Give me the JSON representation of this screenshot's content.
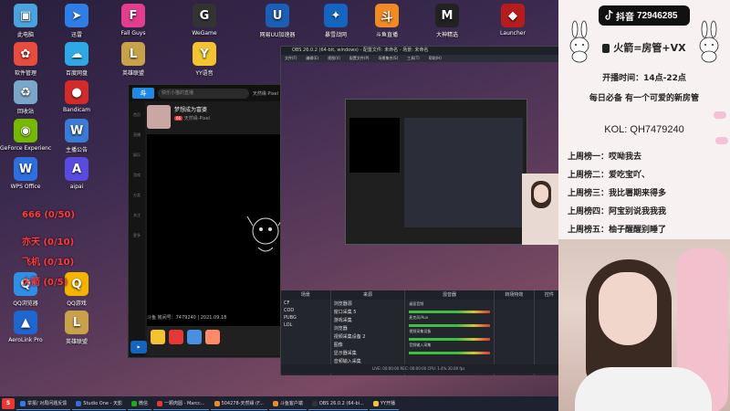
{
  "desktop_icons": [
    {
      "label": "此电脑",
      "icon": "computer-icon",
      "color": "#4aa3df",
      "glyph": "▣"
    },
    {
      "label": "迅雷",
      "icon": "xunlei-icon",
      "color": "#2f7ee6",
      "glyph": "➤"
    },
    {
      "label": "Fall Guys",
      "icon": "fallguys-icon",
      "color": "#e23d8f",
      "glyph": "F"
    },
    {
      "label": "WeGame",
      "icon": "wegame-icon",
      "color": "#333333",
      "glyph": "G"
    },
    {
      "label": "网易UU加速器",
      "icon": "uu-icon",
      "color": "#1c5db5",
      "glyph": "U"
    },
    {
      "label": "暴雪战网",
      "icon": "battlenet-icon",
      "color": "#1565c0",
      "glyph": "✦"
    },
    {
      "label": "斗鱼直播",
      "icon": "douyu-icon",
      "color": "#f08a24",
      "glyph": "斗"
    },
    {
      "label": "大神精选",
      "icon": "mw-icon",
      "color": "#222222",
      "glyph": "M"
    },
    {
      "label": "Launcher",
      "icon": "launcher-icon",
      "color": "#b71c1c",
      "glyph": "◆"
    },
    {
      "label": "软件管理",
      "icon": "apps-icon",
      "color": "#e84c3d",
      "glyph": "✿"
    },
    {
      "label": "百度网盘",
      "icon": "baidu-icon",
      "color": "#2fa8e6",
      "glyph": "☁"
    },
    {
      "label": "英雄联盟",
      "icon": "lol-icon",
      "color": "#c8a24a",
      "glyph": "L"
    },
    {
      "label": "YY语音",
      "icon": "yy-icon",
      "color": "#f4c430",
      "glyph": "Y"
    },
    {
      "label": "回收站",
      "icon": "recycle-bin-icon",
      "color": "#7aa6c9",
      "glyph": "♻"
    },
    {
      "label": "Bandicam",
      "icon": "bandicam-icon",
      "color": "#d42a2a",
      "glyph": "●"
    },
    {
      "label": "GeForce Experience",
      "icon": "geforce-icon",
      "color": "#76b900",
      "glyph": "◉"
    },
    {
      "label": "主播公告",
      "icon": "doc-icon",
      "color": "#3a7bd5",
      "glyph": "W"
    },
    {
      "label": "WPS Office",
      "icon": "wps-icon",
      "color": "#2d6fe0",
      "glyph": "W"
    },
    {
      "label": "aipai",
      "icon": "aipai-icon",
      "color": "#5a4be0",
      "glyph": "A"
    },
    {
      "label": "QQ浏览器",
      "icon": "qqbrowser-icon",
      "color": "#2f8ee6",
      "glyph": "Q"
    },
    {
      "label": "QQ游戏",
      "icon": "qqgame-icon",
      "color": "#f4b400",
      "glyph": "Q"
    },
    {
      "label": "AeroLink Pro",
      "icon": "aerolink-icon",
      "color": "#1e66d0",
      "glyph": "▲"
    },
    {
      "label": "英雄联盟",
      "icon": "lol2-icon",
      "color": "#c8a24a",
      "glyph": "L"
    }
  ],
  "danmu": [
    {
      "text": "666 (0/50)"
    },
    {
      "text": "亦天 (0/10)"
    },
    {
      "text": "飞机 (0/10)"
    },
    {
      "text": "火箭 (0/5)"
    }
  ],
  "stream_window": {
    "search_placeholder": "快乐小猫的直播",
    "tabs_label": "天然缘 Pixel",
    "streamer_title": "梦想成为富婆",
    "streamer_sub": "天然缘-Pixel",
    "level": "66",
    "footer": "斗鱼 房间号：7479240 | 2021.09.18",
    "sidebar": [
      "首页",
      "直播",
      "娱乐",
      "游戏",
      "分类",
      "关注",
      "更多"
    ]
  },
  "obs": {
    "title": "OBS 26.0.2 (64-bit, windows) - 配置文件: 未命名 - 场景: 未命名",
    "menu": [
      "文件(F)",
      "编辑(E)",
      "视图(V)",
      "配置文件(P)",
      "场景集合(S)",
      "工具(T)",
      "帮助(H)"
    ],
    "panels": [
      "场景",
      "来源",
      "混音器",
      "转场特效",
      "控件"
    ],
    "scenes": [
      "CF",
      "COD",
      "PUBG",
      "LOL"
    ],
    "sources": [
      "浏览器源",
      "窗口采集 5",
      "游戏采集",
      "浏览器",
      "视频采集设备 2",
      "图像",
      "显示器采集",
      "音频输入采集"
    ],
    "mixer": [
      "桌面音频",
      "麦克风/Aux",
      "视频采集设备",
      "音频输入采集"
    ],
    "status": "LIVE: 00:00:00  REC: 00:00:00  CPU: 1.4%  30.00 fps"
  },
  "right_panel": {
    "tiktok_label": "抖音",
    "tiktok_id": "72946285",
    "promo": "火箭=房管+VX",
    "hours": "开播时间：14点-22点",
    "daily": "每日必备 有一个可爱的新房管",
    "kol": "KOL: QH7479240",
    "ranks": [
      "上周榜一：哎呦我去",
      "上周榜二：爱吃宝吖、",
      "上周榜三：我比署期来得多",
      "上周榜四：阿宝别说我我我",
      "上周榜五：柚子醒醒别睡了"
    ]
  },
  "taskbar": [
    {
      "label": "举报/ 对局问题反馈",
      "color": "#2f7ee6"
    },
    {
      "label": "Studio One - 天影",
      "color": "#3a6bd5"
    },
    {
      "label": "微信",
      "color": "#1aad19"
    },
    {
      "label": "一颗肉圆 - Marcc...",
      "color": "#e53935"
    },
    {
      "label": "504278-天然缘 (F...",
      "color": "#f08a24"
    },
    {
      "label": "斗鱼客户端",
      "color": "#f08a24"
    },
    {
      "label": "OBS 26.0.2 (64-bi...",
      "color": "#333333"
    },
    {
      "label": "YY开播",
      "color": "#f4c430"
    }
  ]
}
